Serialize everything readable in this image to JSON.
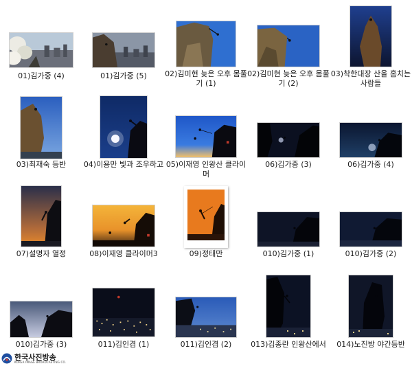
{
  "thumbnails": [
    {
      "name": "01)김가중 (4)",
      "scene": "city-day"
    },
    {
      "name": "01)김가중 (5)",
      "scene": "city-dusk"
    },
    {
      "name": "02)김미현 늦은 오후 몸풀기 (1)",
      "scene": "rock-blue"
    },
    {
      "name": "02)김미현 늦은 오후 몸풀기 (2)",
      "scene": "rock-blue"
    },
    {
      "name": "03)착한대장 산을 홈치는 사람들",
      "scene": "rock-night"
    },
    {
      "name": "03)최재숙 등반",
      "scene": "rock-blue"
    },
    {
      "name": "04)이용만 빛과 조우하고",
      "scene": "moon"
    },
    {
      "name": "05)이재영 인왕산 클라이머",
      "scene": "sunset-blue"
    },
    {
      "name": "06)김가중 (3)",
      "scene": "night"
    },
    {
      "name": "06)김가중 (4)",
      "scene": "night"
    },
    {
      "name": "07)설명자 열정",
      "scene": "sunset"
    },
    {
      "name": "08)이재영 클라이머3",
      "scene": "golden"
    },
    {
      "name": "09)정태만",
      "scene": "orange-framed"
    },
    {
      "name": "010)김가중 (1)",
      "scene": "night"
    },
    {
      "name": "010)김가중 (2)",
      "scene": "night"
    },
    {
      "name": "010)김가중 (3)",
      "scene": "dusk"
    },
    {
      "name": "011)김인겸 (1)",
      "scene": "city-night"
    },
    {
      "name": "011)김인겸 (2)",
      "scene": "city-blue"
    },
    {
      "name": "013)김종란 인왕산에서",
      "scene": "rock-night"
    },
    {
      "name": "014)노진방 야간등반",
      "scene": "rock-night"
    }
  ],
  "watermark": {
    "title": "한국사진방송",
    "subtitle": "KOREA IMAGE BROADCASTING CO."
  },
  "colors": {
    "sky_blue": "#2f6fd0",
    "night": "#0b1020",
    "sunset": "#e88a2a",
    "caption_text": "#1a1a1a"
  }
}
